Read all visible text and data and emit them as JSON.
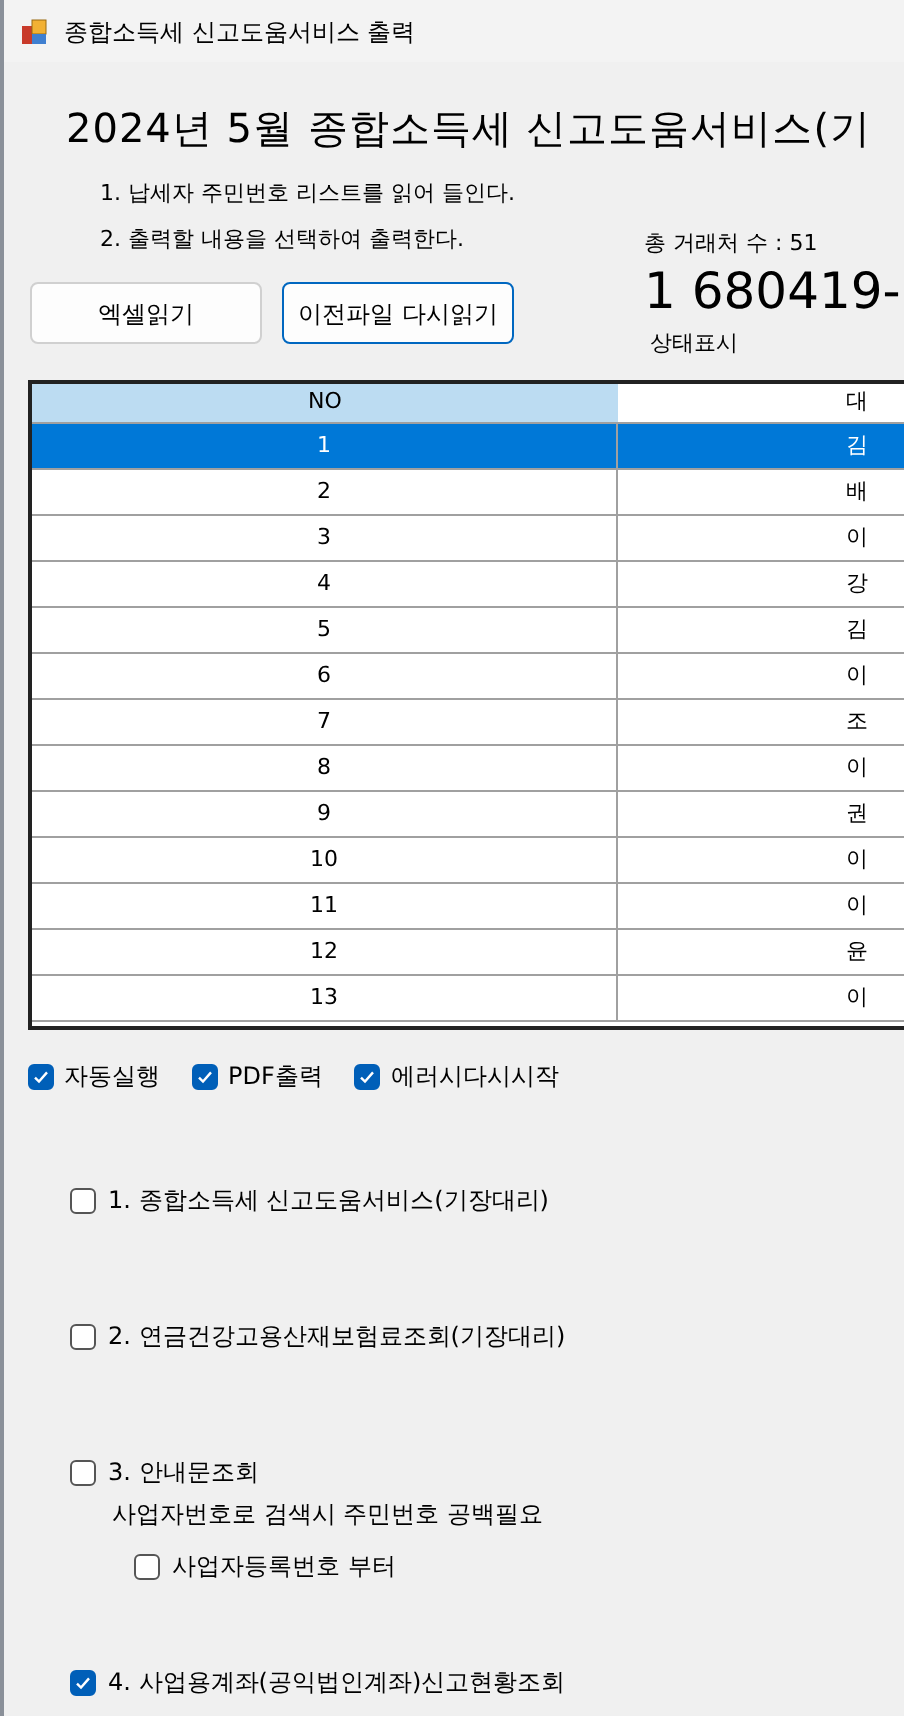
{
  "window": {
    "title": "종합소득세 신고도움서비스 출력"
  },
  "heading": "2024년 5월 종합소득세 신고도움서비스(기",
  "instructions": [
    "1. 납세자 주민번호 리스트를 읽어 들인다.",
    "2. 출력할 내용을 선택하여 출력한다."
  ],
  "total_label": "총 거래처 수 : 51",
  "current_id": "1 680419-",
  "status": "상태표시",
  "buttons": [
    {
      "label": "엑셀읽기",
      "focused": false
    },
    {
      "label": "이전파일 다시읽기",
      "focused": true
    }
  ],
  "table": {
    "columns": [
      "NO",
      "대"
    ],
    "rows": [
      {
        "cells": [
          "1",
          "김"
        ],
        "selected": true
      },
      {
        "cells": [
          "2",
          "배"
        ],
        "selected": false
      },
      {
        "cells": [
          "3",
          "이"
        ],
        "selected": false
      },
      {
        "cells": [
          "4",
          "강"
        ],
        "selected": false
      },
      {
        "cells": [
          "5",
          "김"
        ],
        "selected": false
      },
      {
        "cells": [
          "6",
          "이"
        ],
        "selected": false
      },
      {
        "cells": [
          "7",
          "조"
        ],
        "selected": false
      },
      {
        "cells": [
          "8",
          "이"
        ],
        "selected": false
      },
      {
        "cells": [
          "9",
          "권"
        ],
        "selected": false
      },
      {
        "cells": [
          "10",
          "이"
        ],
        "selected": false
      },
      {
        "cells": [
          "11",
          "이"
        ],
        "selected": false
      },
      {
        "cells": [
          "12",
          "윤"
        ],
        "selected": false
      },
      {
        "cells": [
          "13",
          "이"
        ],
        "selected": false
      }
    ]
  },
  "options": [
    {
      "label": "자동실행",
      "checked": true
    },
    {
      "label": "PDF출력",
      "checked": true
    },
    {
      "label": "에러시다시시작",
      "checked": true
    }
  ],
  "tasks": [
    {
      "label": "1. 종합소득세 신고도움서비스(기장대리)",
      "checked": false
    },
    {
      "label": "2. 연금건강고용산재보험료조회(기장대리)",
      "checked": false
    },
    {
      "label": "3. 안내문조회",
      "checked": false,
      "note": "사업자번호로 검색시 주민번호 공백필요",
      "children": [
        {
          "label": "사업자등록번호 부터",
          "checked": false
        }
      ]
    },
    {
      "label": "4. 사업용계좌(공익법인계좌)신고현황조회",
      "checked": true
    }
  ]
}
